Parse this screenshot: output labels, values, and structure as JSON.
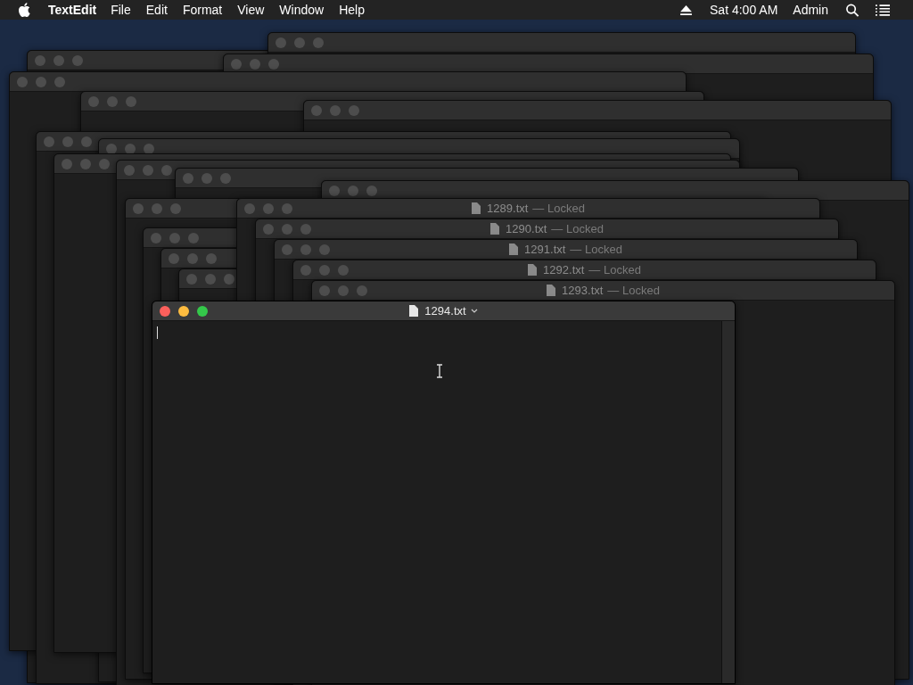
{
  "menu_bar": {
    "app_name": "TextEdit",
    "menus": [
      "File",
      "Edit",
      "Format",
      "View",
      "Window",
      "Help"
    ],
    "clock": "Sat 4:00 AM",
    "user": "Admin"
  },
  "locked_windows": [
    {
      "title": "1289.txt",
      "status": "— Locked"
    },
    {
      "title": "1290.txt",
      "status": "— Locked"
    },
    {
      "title": "1291.txt",
      "status": "— Locked"
    },
    {
      "title": "1292.txt",
      "status": "— Locked"
    },
    {
      "title": "1293.txt",
      "status": "— Locked"
    }
  ],
  "active_window": {
    "title": "1294.txt"
  }
}
